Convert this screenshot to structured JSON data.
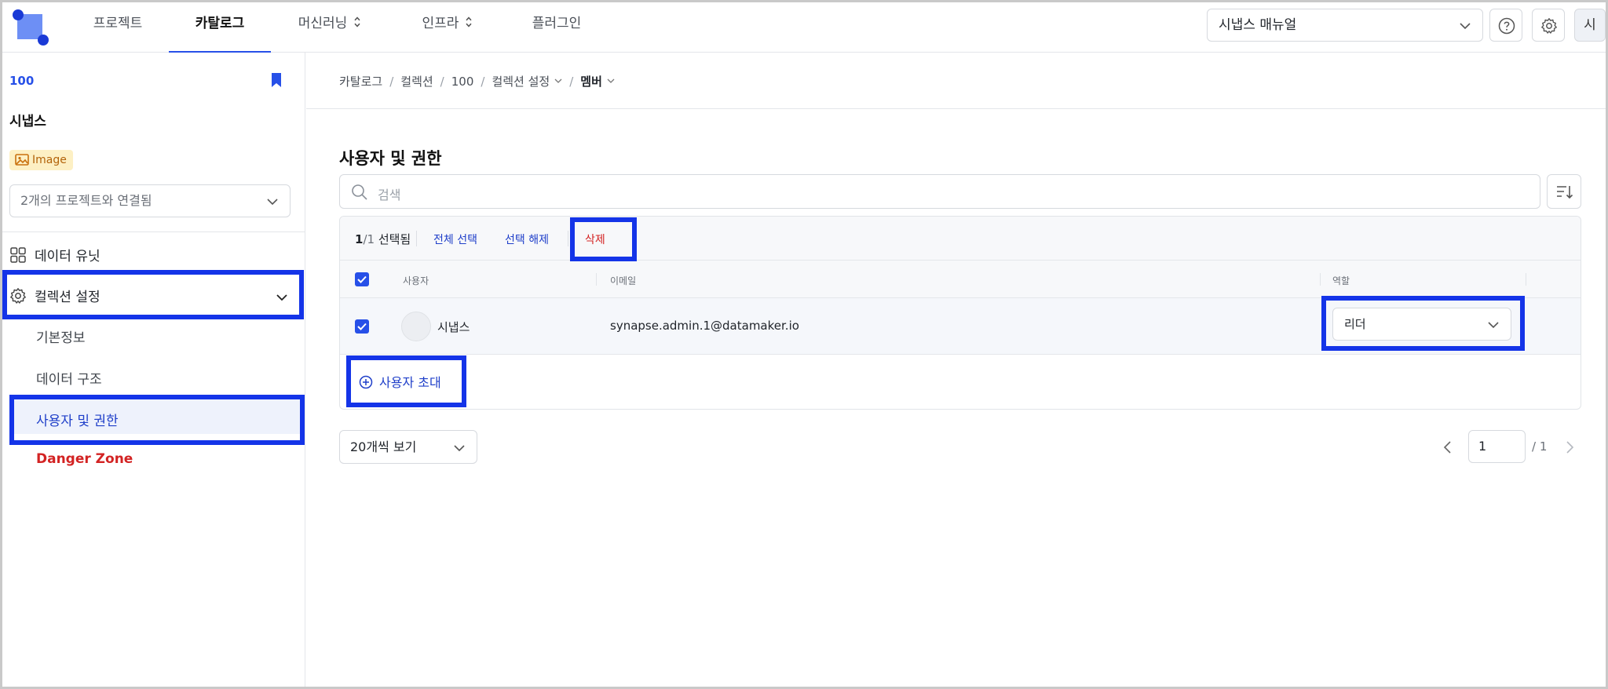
{
  "topbar": {
    "nav": [
      {
        "label": "프로젝트"
      },
      {
        "label": "카탈로그"
      },
      {
        "label": "머신러닝"
      },
      {
        "label": "인프라"
      },
      {
        "label": "플러그인"
      }
    ],
    "updown_glyph": "⌃⌄",
    "manual_select": "시냅스 매뉴얼",
    "avatar": "시"
  },
  "sidebar": {
    "id": "100",
    "name": "시냅스",
    "badge": "Image",
    "project_select": "2개의 프로젝트와 연결됨",
    "menu": {
      "data_units": "데이터 유닛",
      "collection_settings": "컬렉션 설정"
    },
    "sub": {
      "basic_info": "기본정보",
      "data_structure": "데이터 구조",
      "users_permissions": "사용자 및 권한",
      "danger_zone": "Danger Zone"
    }
  },
  "breadcrumb": {
    "items": [
      "카탈로그",
      "컬렉션",
      "100",
      "컬렉션 설정",
      "멤버"
    ],
    "sep": "/"
  },
  "main": {
    "title": "사용자 및 권한",
    "search_placeholder": "검색",
    "toolbar": {
      "selected_count": "1",
      "selected_total": "/1",
      "selected_suffix": "선택됨",
      "select_all": "전체 선택",
      "deselect": "선택 해제",
      "delete": "삭제"
    },
    "columns": {
      "user": "사용자",
      "email": "이메일",
      "role": "역할"
    },
    "rows": [
      {
        "name": "시냅스",
        "email": "synapse.admin.1@datamaker.io",
        "role": "리더"
      }
    ],
    "invite": "사용자 초대"
  },
  "footer": {
    "page_size": "20개씩 보기",
    "page": "1",
    "total_pages": "/ 1"
  },
  "colors": {
    "accent": "#2750e8",
    "danger": "#d32323",
    "highlight": "#1434e8",
    "badge_bg": "#fdf0c4"
  }
}
